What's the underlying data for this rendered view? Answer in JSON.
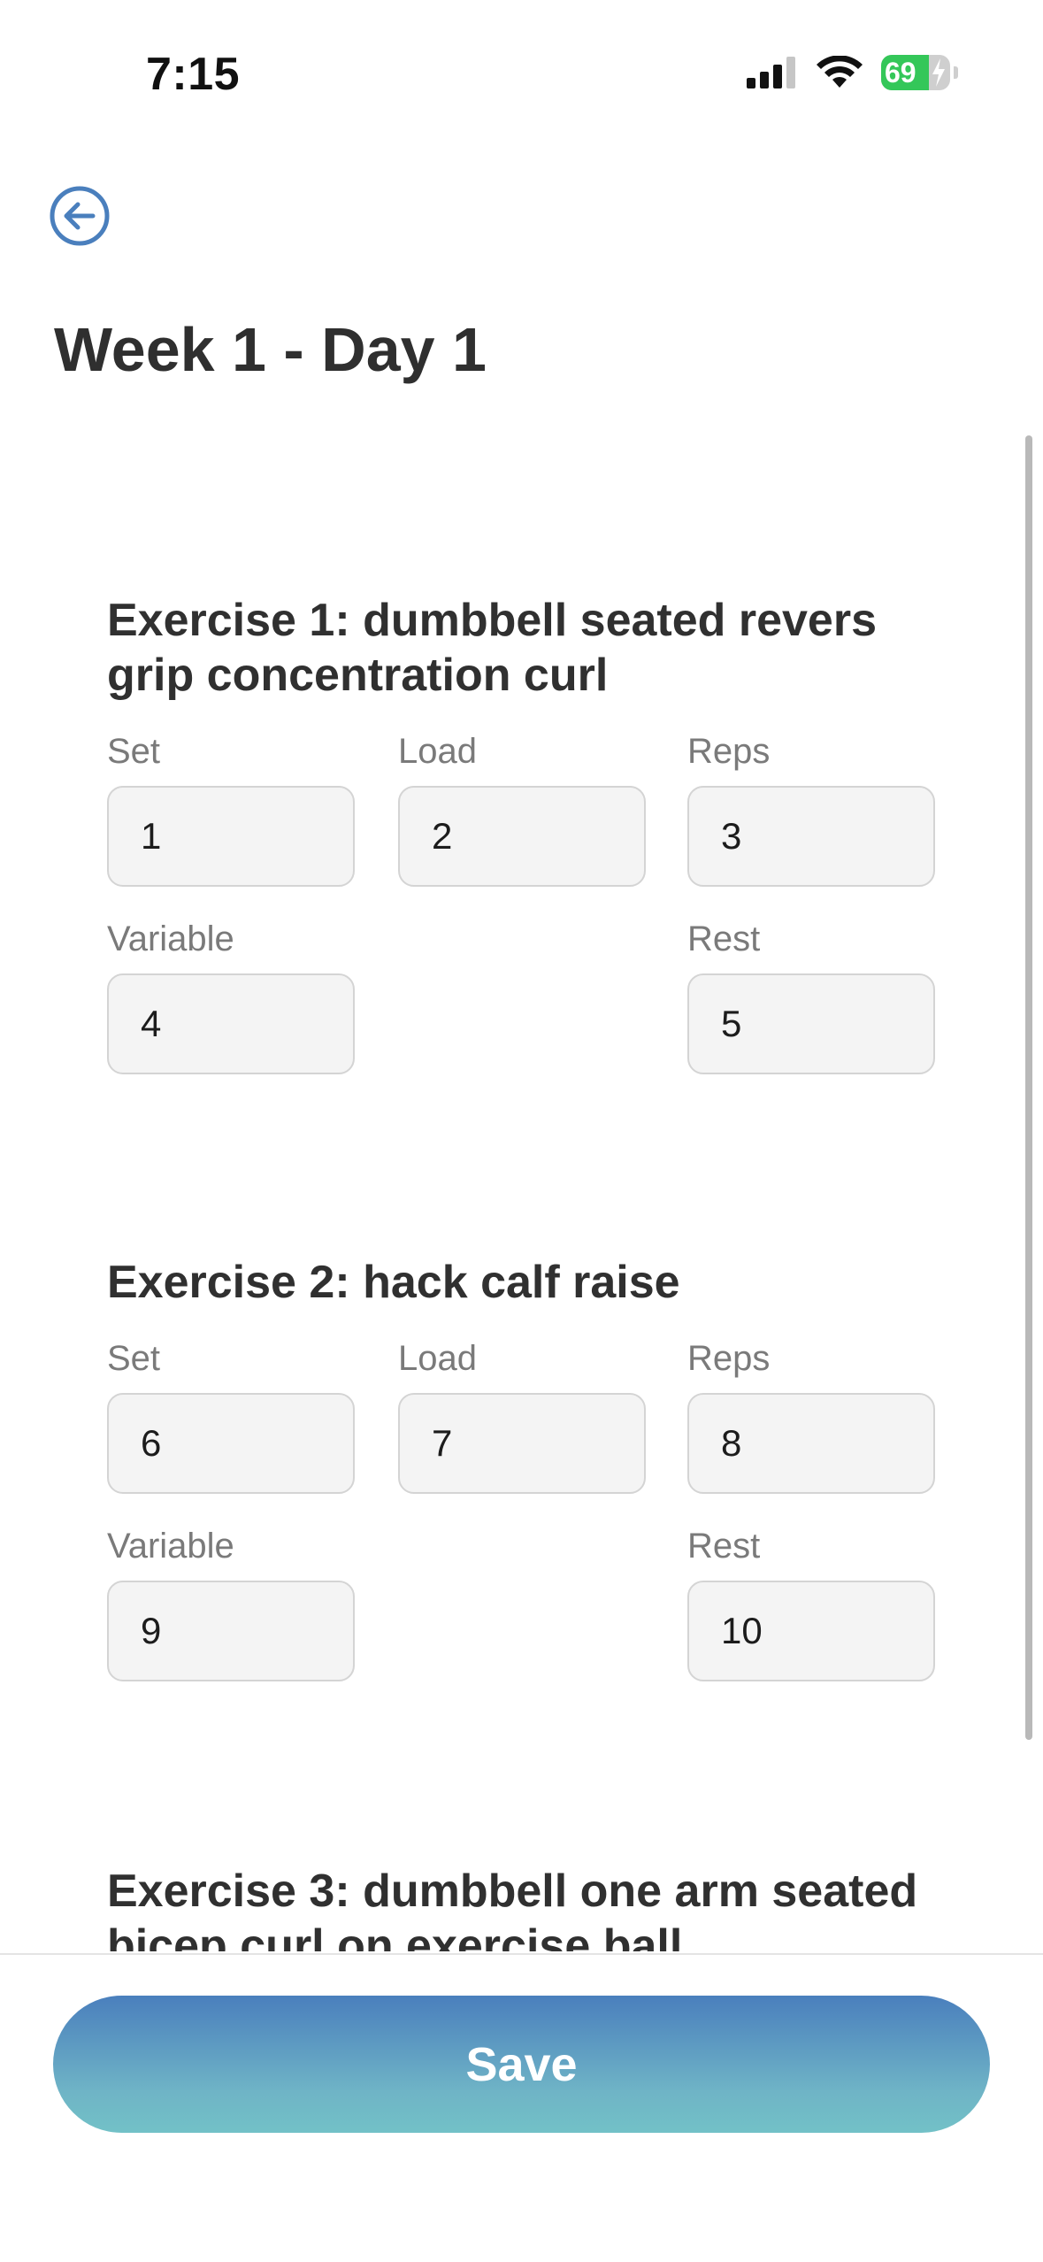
{
  "status_bar": {
    "time": "7:15",
    "battery": "69",
    "battery_level": 0.69,
    "icons": [
      "signal-icon",
      "wifi-icon",
      "battery-icon",
      "charging-bolt-icon"
    ]
  },
  "header": {
    "back_icon": "back-arrow-icon",
    "title": "Week 1 - Day 1"
  },
  "colors": {
    "accent": "#4a7fbd",
    "gradient_end": "#72c1c7",
    "battery_green": "#34c759",
    "input_bg": "#f4f4f4"
  },
  "exercises": [
    {
      "title": "Exercise 1: dumbbell seated revers grip concentration curl",
      "labels": {
        "set": "Set",
        "load": "Load",
        "reps": "Reps",
        "variable": "Variable",
        "rest": "Rest"
      },
      "values": {
        "set": "1",
        "load": "2",
        "reps": "3",
        "variable": "4",
        "rest": "5"
      }
    },
    {
      "title": "Exercise 2: hack calf raise",
      "labels": {
        "set": "Set",
        "load": "Load",
        "reps": "Reps",
        "variable": "Variable",
        "rest": "Rest"
      },
      "values": {
        "set": "6",
        "load": "7",
        "reps": "8",
        "variable": "9",
        "rest": "10"
      }
    },
    {
      "title": "Exercise 3: dumbbell one arm seated bicep curl on exercise ball"
    }
  ],
  "footer": {
    "save_label": "Save"
  }
}
